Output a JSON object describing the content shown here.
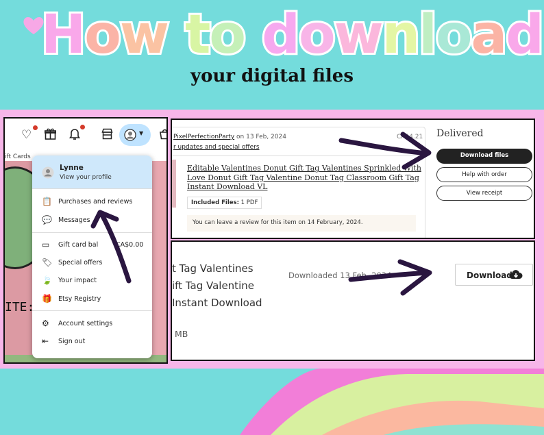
{
  "title": {
    "letters": [
      {
        "ch": "H",
        "color": "#f9a8ea"
      },
      {
        "ch": "o",
        "color": "#fbb4a7"
      },
      {
        "ch": "w",
        "color": "#fbc3a3"
      },
      {
        "ch": " ",
        "color": "#fff"
      },
      {
        "ch": "t",
        "color": "#d8f5a4"
      },
      {
        "ch": "o",
        "color": "#c5f0b8"
      },
      {
        "ch": " ",
        "color": "#fff"
      },
      {
        "ch": "d",
        "color": "#f6a9ef"
      },
      {
        "ch": "o",
        "color": "#f8b5e8"
      },
      {
        "ch": "w",
        "color": "#fbb7dc"
      },
      {
        "ch": "n",
        "color": "#e4f6a4"
      },
      {
        "ch": "l",
        "color": "#bfeec2"
      },
      {
        "ch": "o",
        "color": "#a9e8d6"
      },
      {
        "ch": "a",
        "color": "#fbb4a5"
      },
      {
        "ch": "d",
        "color": "#f9a8ea"
      }
    ],
    "subtitle": "your digital files"
  },
  "colors": {
    "background": "#74dcdc",
    "band": "#f7b6e9",
    "arrow": "#2a1640",
    "heart": "#f7a8e6"
  },
  "left_panel": {
    "gift_cards": "ift Cards",
    "side_text": "ITE:",
    "nav_icons": [
      "heart-icon",
      "gift-icon",
      "bell-icon",
      "shop-icon",
      "avatar-icon",
      "cart-icon"
    ],
    "menu": {
      "profile_name": "Lynne",
      "profile_sub": "View your profile",
      "items": [
        {
          "icon": "▤",
          "label": "Purchases and reviews"
        },
        {
          "icon": "💬",
          "label": "Messages"
        },
        {
          "icon": "▭",
          "label": "Gift card bal"
        },
        {
          "icon": "🏷",
          "label": "Special offers"
        },
        {
          "icon": "🍃",
          "label": "Your impact"
        },
        {
          "icon": "🎁",
          "label": "Etsy Registry"
        },
        {
          "icon": "⚙",
          "label": "Account settings"
        },
        {
          "icon": "⇤",
          "label": "Sign out"
        }
      ],
      "gift_card_value": "CA$0.00"
    }
  },
  "order": {
    "shop": "PixelPerfectionParty",
    "date": " on 13 Feb, 2024",
    "price": "CA$4.21",
    "updates_link": "r updates and special offers",
    "item_title": "Editable Valentines Donut Gift Tag Valentines Sprinkled With Love Donut Gift Tag Valentine Donut Tag Classroom Gift Tag Instant Download VL",
    "files_label": "Included Files:",
    "files_value": " 1 PDF",
    "review_note": "You can leave a review for this item on 14 February, 2024.",
    "status": "Delivered",
    "buttons": {
      "download_files": "Download files",
      "help": "Help with order",
      "receipt": "View receipt"
    }
  },
  "download_panel": {
    "lines": [
      "t Tag Valentines",
      "ift Tag Valentine",
      " Instant Download"
    ],
    "downloaded": "Downloaded 13 Feb, 2024",
    "size": "MB",
    "download_label": "Download"
  }
}
